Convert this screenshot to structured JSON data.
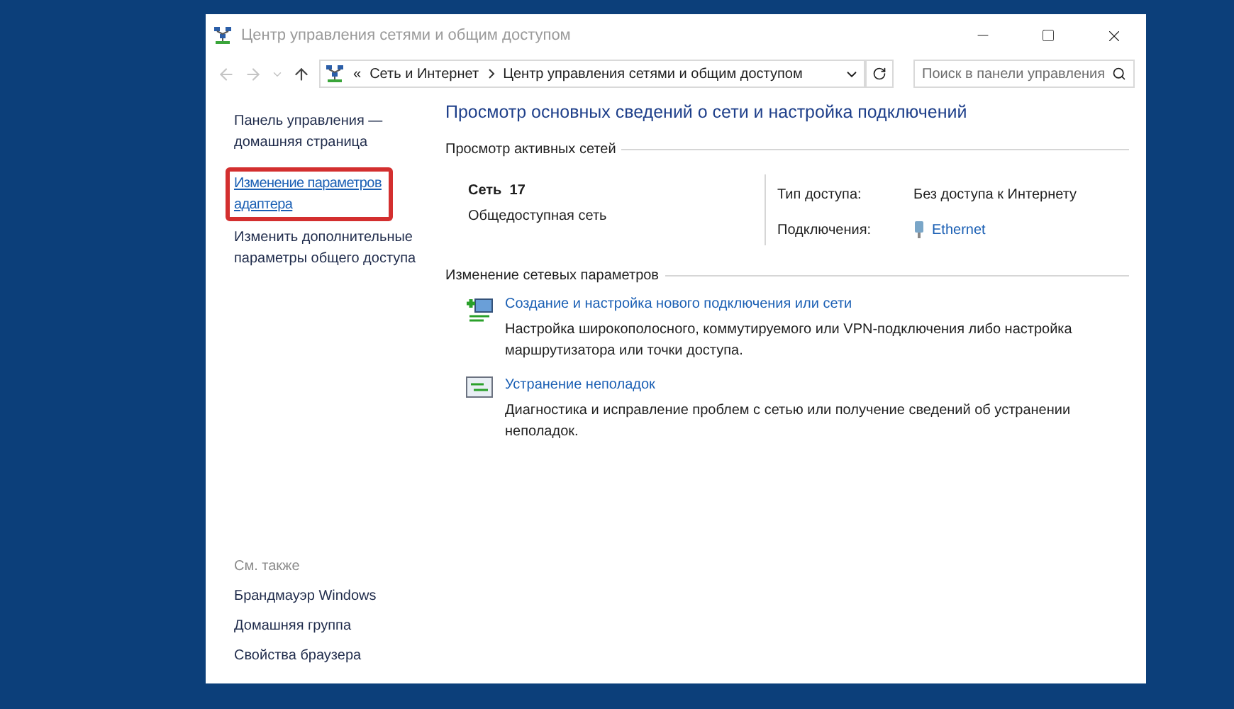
{
  "window": {
    "title": "Центр управления сетями и общим доступом"
  },
  "address_bar": {
    "overflow": "«",
    "path": [
      {
        "label": "Сеть и Интернет"
      },
      {
        "label": "Центр управления сетями и общим доступом"
      }
    ]
  },
  "search": {
    "placeholder": "Поиск в панели управления"
  },
  "sidebar": {
    "items": [
      {
        "label": "Панель управления — домашняя страница",
        "kind": "text",
        "highlighted": false
      },
      {
        "label": "Изменение параметров адаптера",
        "kind": "link",
        "highlighted": true
      },
      {
        "label": "Изменить дополнительные параметры общего доступа",
        "kind": "text",
        "highlighted": false
      }
    ],
    "see_also": {
      "heading": "См. также",
      "items": [
        "Брандмауэр Windows",
        "Домашняя группа",
        "Свойства браузера"
      ]
    }
  },
  "main": {
    "title": "Просмотр основных сведений о сети и настройка подключений",
    "active_networks": {
      "heading": "Просмотр активных сетей",
      "name": "Сеть  17",
      "category": "Общедоступная сеть",
      "access_label": "Тип доступа:",
      "access_value": "Без доступа к Интернету",
      "connections_label": "Подключения:",
      "connections_value": "Ethernet"
    },
    "change_settings": {
      "heading": "Изменение сетевых параметров",
      "tasks": [
        {
          "kind": "new-connection",
          "title": "Создание и настройка нового подключения или сети",
          "description": "Настройка широкополосного, коммутируемого или VPN-подключения либо настройка маршрутизатора или точки доступа."
        },
        {
          "kind": "troubleshoot",
          "title": "Устранение неполадок",
          "description": "Диагностика и исправление проблем с сетью или получение сведений об устранении неполадок."
        }
      ]
    }
  }
}
